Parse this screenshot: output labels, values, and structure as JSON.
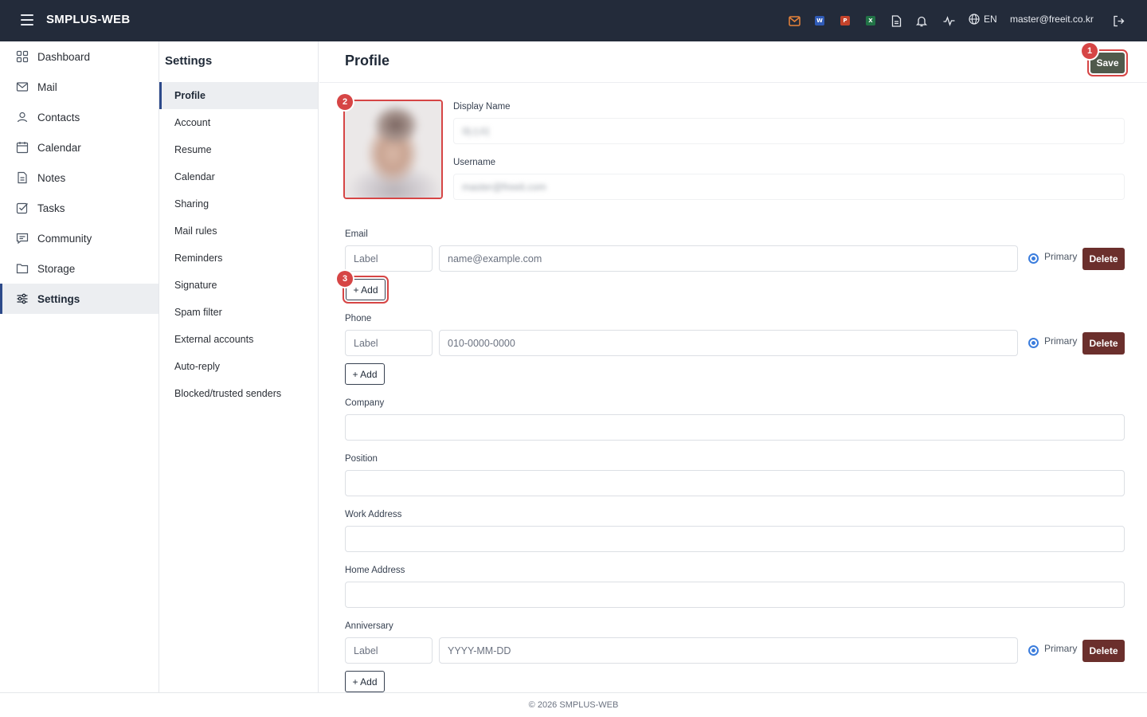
{
  "app": {
    "brand": "SMPLUS-WEB"
  },
  "topbar": {
    "icons": [
      "mail-app-icon",
      "word-app-icon",
      "powerpoint-app-icon",
      "excel-app-icon",
      "document-icon",
      "bell-icon",
      "activity-icon",
      "globe-icon",
      "logout-icon"
    ],
    "app_badges": {
      "word": "W",
      "powerpoint": "P",
      "excel": "X"
    },
    "language": "EN",
    "user_email": "master@freeit.co.kr"
  },
  "sidebar": {
    "items": [
      {
        "label": "Dashboard",
        "icon": "dashboard-icon"
      },
      {
        "label": "Mail",
        "icon": "mail-icon"
      },
      {
        "label": "Contacts",
        "icon": "contacts-icon"
      },
      {
        "label": "Calendar",
        "icon": "calendar-icon"
      },
      {
        "label": "Notes",
        "icon": "notes-icon"
      },
      {
        "label": "Tasks",
        "icon": "tasks-icon"
      },
      {
        "label": "Community",
        "icon": "community-icon"
      },
      {
        "label": "Storage",
        "icon": "folder-icon"
      },
      {
        "label": "Settings",
        "icon": "settings-icon",
        "active": true
      }
    ]
  },
  "settings_menu": {
    "title": "Settings",
    "items": [
      "Profile",
      "Account",
      "Resume",
      "Calendar",
      "Sharing",
      "Mail rules",
      "Reminders",
      "Signature",
      "Spam filter",
      "External accounts",
      "Auto-reply",
      "Blocked/trusted senders"
    ],
    "active": "Profile"
  },
  "main": {
    "title": "Profile",
    "save_label": "Save",
    "badges": [
      "1",
      "2",
      "3"
    ],
    "display_name": {
      "label": "Display Name",
      "value": "마스터"
    },
    "username": {
      "label": "Username",
      "value": "master@freeit.com"
    },
    "email": {
      "label": "Email",
      "label_placeholder": "Label",
      "value_placeholder": "name@example.com",
      "primary": "Primary",
      "delete": "Delete",
      "add": "+ Add"
    },
    "phone": {
      "label": "Phone",
      "label_placeholder": "Label",
      "value_placeholder": "010-0000-0000",
      "primary": "Primary",
      "delete": "Delete",
      "add": "+ Add"
    },
    "company": {
      "label": "Company"
    },
    "position": {
      "label": "Position"
    },
    "work_address": {
      "label": "Work Address"
    },
    "home_address": {
      "label": "Home Address"
    },
    "anniversary": {
      "label": "Anniversary",
      "label_placeholder": "Label",
      "value_placeholder": "YYYY-MM-DD",
      "primary": "Primary",
      "delete": "Delete",
      "add": "+ Add"
    }
  },
  "footer": {
    "text": "© 2026 SMPLUS-WEB"
  },
  "colors": {
    "topbar": "#232b3a",
    "accent": "#2d4a8a",
    "save": "#505a4c",
    "delete": "#6b2f2c",
    "highlight": "#d64545",
    "radio": "#3b7ddd"
  }
}
